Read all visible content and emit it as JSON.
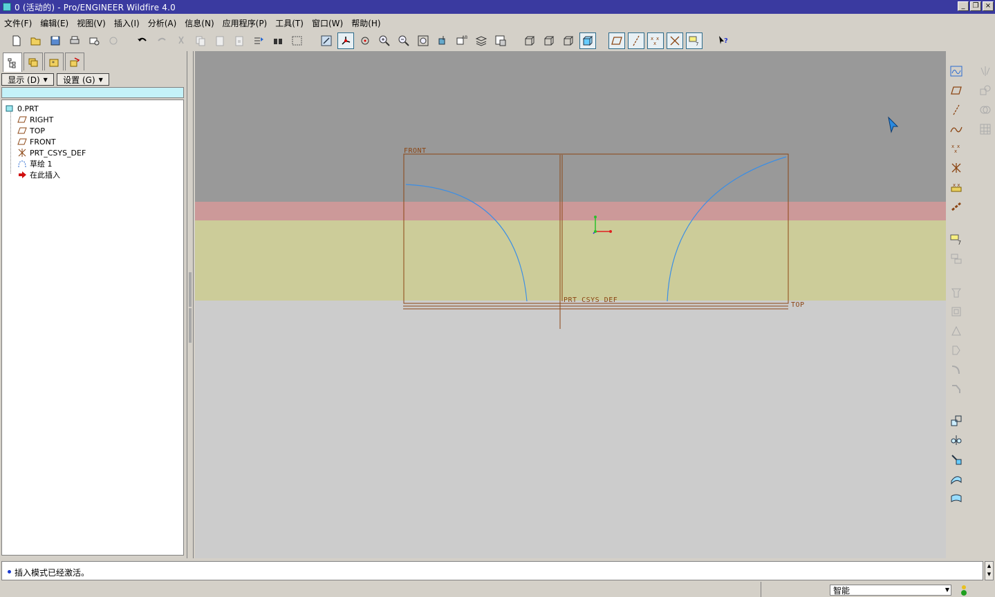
{
  "window": {
    "title": "0 (活动的) - Pro/ENGINEER Wildfire 4.0",
    "min_label": "_",
    "restore_label": "❐",
    "close_label": "×"
  },
  "menu": {
    "items": [
      "文件(F)",
      "编辑(E)",
      "视图(V)",
      "插入(I)",
      "分析(A)",
      "信息(N)",
      "应用程序(P)",
      "工具(T)",
      "窗口(W)",
      "帮助(H)"
    ]
  },
  "panel": {
    "show_label": "显示 (D)",
    "settings_label": "设置 (G)",
    "tree": {
      "root": "0.PRT",
      "items": [
        "RIGHT",
        "TOP",
        "FRONT",
        "PRT_CSYS_DEF",
        "草绘 1",
        "在此插入"
      ]
    }
  },
  "viewport": {
    "labels": {
      "front": "FRONT",
      "top": "TOP",
      "csys": "PRT_CSYS_DEF"
    }
  },
  "status": {
    "message": "插入模式已经激活。",
    "filter_value": "智能"
  },
  "colors": {
    "title_bg": "#3a3aa0",
    "viewport_top": "#999999",
    "viewport_pink": "#cc9999",
    "viewport_yellow": "#cccc99",
    "viewport_bottom": "#cccccc",
    "datum": "#8b4513",
    "curve": "#3a8ee6"
  }
}
